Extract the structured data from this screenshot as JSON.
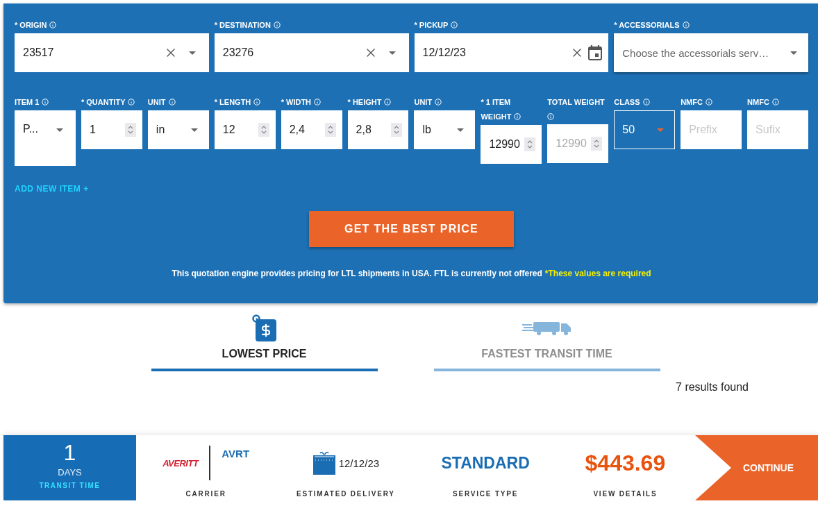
{
  "form": {
    "row_1": [
      {
        "label": "* ORIGIN",
        "kind": "combo",
        "value": "23517"
      },
      {
        "label": "* DESTINATION",
        "kind": "combo",
        "value": "23276"
      },
      {
        "label": "* PICKUP",
        "kind": "date",
        "value": "12/12/23"
      },
      {
        "label": "* ACCESSORIALS",
        "kind": "select",
        "placeholder": "Choose the accessorials serv…"
      }
    ],
    "row_2": [
      {
        "label": "ITEM 1",
        "kind": "item",
        "value": "P...",
        "focused": false,
        "disabled": false
      },
      {
        "label": "* QUANTITY",
        "kind": "number",
        "value": "1",
        "focused": false,
        "disabled": false
      },
      {
        "label": "UNIT",
        "kind": "select",
        "value": "in",
        "focused": false,
        "disabled": false
      },
      {
        "label": "* LENGTH",
        "kind": "number",
        "value": "12",
        "focused": false,
        "disabled": false
      },
      {
        "label": "* WIDTH",
        "kind": "number",
        "value": "2,4",
        "focused": false,
        "disabled": false
      },
      {
        "label": "* HEIGHT",
        "kind": "number",
        "value": "2,8",
        "focused": false,
        "disabled": false
      },
      {
        "label": "UNIT",
        "kind": "select",
        "value": "lb",
        "focused": false,
        "disabled": false
      },
      {
        "label": "* 1 ITEM WEIGHT",
        "kind": "number",
        "value": "12990",
        "focused": false,
        "disabled": false
      },
      {
        "label": "TOTAL WEIGHT",
        "kind": "number",
        "value": "12990",
        "focused": false,
        "disabled": true
      },
      {
        "label": "CLASS",
        "kind": "select",
        "value": "50",
        "focused": true,
        "disabled": false
      },
      {
        "label": "NMFC",
        "kind": "text",
        "placeholder": "Prefix",
        "focused": false,
        "disabled": false
      },
      {
        "label": "NMFC",
        "kind": "text",
        "placeholder": "Sufix",
        "focused": false,
        "disabled": false
      }
    ],
    "add_item": "ADD NEW ITEM +",
    "submit": "GET THE BEST PRICE",
    "note": "This quotation engine provides pricing for LTL shipments in USA. FTL is currently not offered",
    "required_note": "*These values are required"
  },
  "tabs": [
    {
      "label": "LOWEST PRICE",
      "kind": "price",
      "selected": true
    },
    {
      "label": "FASTEST TRANSIT TIME",
      "kind": "truck",
      "selected": false
    }
  ],
  "results_count": "7 results found",
  "results": [
    {
      "transit_days": "1",
      "transit_unit": "DAYS",
      "transit_label": "TRANSIT TIME",
      "carrier_logo": "AVERITT",
      "carrier_code": "AVRT",
      "carrier_label": "CARRIER",
      "delivery_date": "12/12/23",
      "delivery_label": "ESTIMATED DELIVERY",
      "service": "STANDARD",
      "service_label": "SERVICE TYPE",
      "price": "$443.69",
      "price_label": "VIEW DETAILS",
      "action": "CONTINUE"
    }
  ]
}
